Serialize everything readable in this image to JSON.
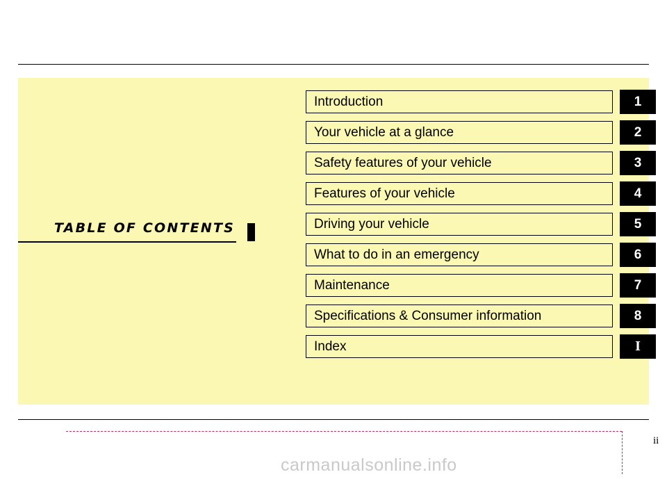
{
  "document": {
    "heading": "TABLE  OF  CONTENTS",
    "page_number": "ii",
    "watermark": "carmanualsonline.info"
  },
  "colors": {
    "panel_background": "#fbf8b4",
    "tab_background": "#000000",
    "tab_text": "#ffffff",
    "rule": "#000000",
    "footer_guide": "#b03060",
    "watermark": "#c9c9c9"
  },
  "chapters": [
    {
      "title": "Introduction",
      "tab": "1"
    },
    {
      "title": "Your vehicle at a glance",
      "tab": "2"
    },
    {
      "title": "Safety features of your vehicle",
      "tab": "3"
    },
    {
      "title": "Features of your vehicle",
      "tab": "4"
    },
    {
      "title": "Driving your vehicle",
      "tab": "5"
    },
    {
      "title": "What to do in an emergency",
      "tab": "6"
    },
    {
      "title": "Maintenance",
      "tab": "7"
    },
    {
      "title": "Specifications & Consumer information",
      "tab": "8"
    },
    {
      "title": "Index",
      "tab": "I"
    }
  ]
}
